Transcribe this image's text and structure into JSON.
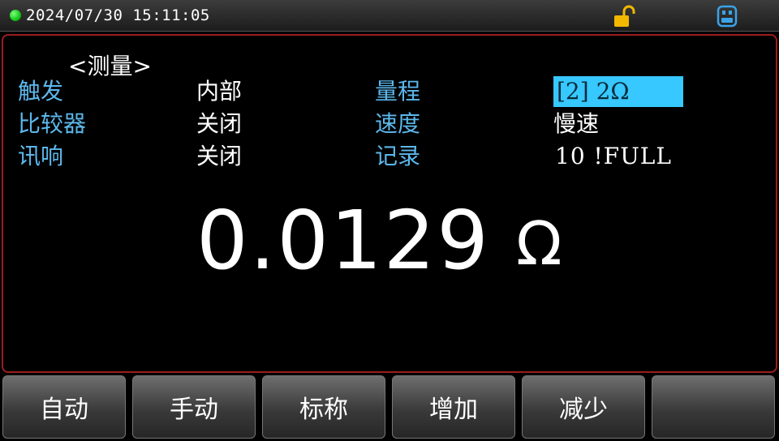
{
  "status": {
    "datetime": "2024/07/30  15:11:05",
    "indicator_color": "#15c515",
    "icons": [
      "lock-open-icon",
      "usb-icon"
    ]
  },
  "panel": {
    "title": "<测量>",
    "params": [
      {
        "label": "触发",
        "value": "内部"
      },
      {
        "label": "比较器",
        "value": "关闭"
      },
      {
        "label": "讯响",
        "value": "关闭"
      },
      {
        "label": "量程",
        "value": "[2] 2Ω"
      },
      {
        "label": "速度",
        "value": "慢速"
      },
      {
        "label": "记录",
        "value": "10 !FULL"
      }
    ],
    "reading": "0.0129",
    "unit": "Ω"
  },
  "softkeys": [
    "自动",
    "手动",
    "标称",
    "增加",
    "减少",
    ""
  ],
  "colors": {
    "label": "#5cb8ec",
    "highlight": "#36c8ff",
    "panel_border": "#9a1e1e"
  }
}
